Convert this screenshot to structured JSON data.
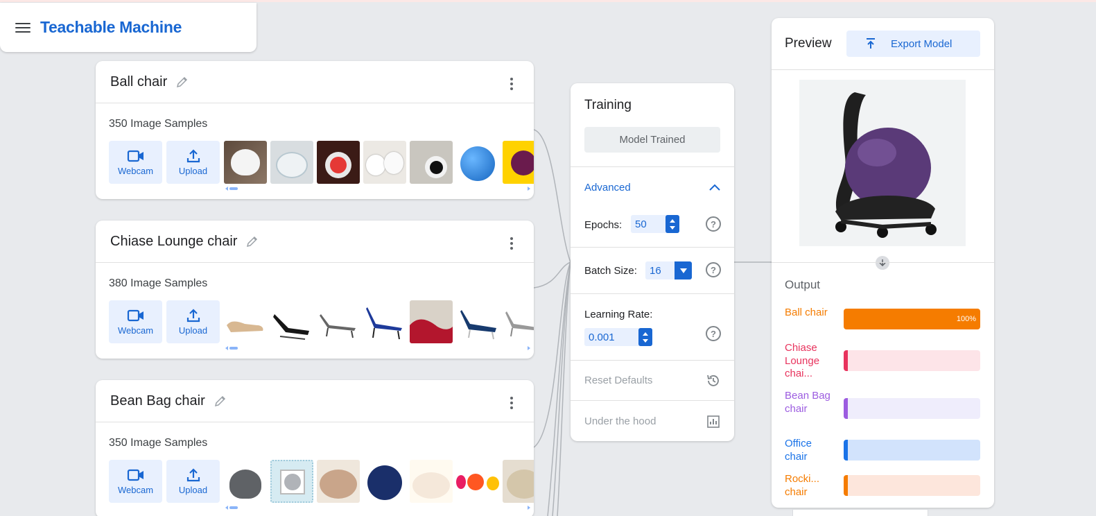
{
  "app": {
    "title": "Teachable Machine"
  },
  "colors": {
    "accent": "#1967d2",
    "ball": "#f57c00",
    "chaise": "#e8335d",
    "beanbag": "#9c5ce0",
    "office": "#1a73e8",
    "rocking": "#f57c00"
  },
  "classes": [
    {
      "name": "Ball chair",
      "samples": "350 Image Samples",
      "webcam": "Webcam",
      "upload": "Upload"
    },
    {
      "name": "Chiase Lounge chair",
      "samples": "380 Image Samples",
      "webcam": "Webcam",
      "upload": "Upload"
    },
    {
      "name": "Bean Bag chair",
      "samples": "350 Image Samples",
      "webcam": "Webcam",
      "upload": "Upload"
    }
  ],
  "training": {
    "title": "Training",
    "status_button": "Model Trained",
    "advanced_label": "Advanced",
    "epochs_label": "Epochs:",
    "epochs_value": "50",
    "batch_label": "Batch Size:",
    "batch_value": "16",
    "lr_label": "Learning Rate:",
    "lr_value": "0.001",
    "help_glyph": "?",
    "reset_label": "Reset Defaults",
    "hood_label": "Under the hood"
  },
  "preview": {
    "title": "Preview",
    "export_label": "Export Model",
    "output_title": "Output",
    "outputs": [
      {
        "label": "Ball chair",
        "confidence": 1.0,
        "value_text": "100%",
        "color": "#f57c00",
        "track": "#f57c00"
      },
      {
        "label": "Chiase Lounge chai...",
        "confidence": 0.0,
        "value_text": "",
        "color": "#e8335d",
        "track": "#fde4e8"
      },
      {
        "label": "Bean Bag chair",
        "confidence": 0.0,
        "value_text": "",
        "color": "#9c5ce0",
        "track": "#efedfc"
      },
      {
        "label": "Office chair",
        "confidence": 0.0,
        "value_text": "",
        "color": "#1a73e8",
        "track": "#d2e3fc"
      },
      {
        "label": "Rocki... chair",
        "confidence": 0.0,
        "value_text": "",
        "color": "#f57c00",
        "track": "#fde6dc"
      }
    ]
  }
}
